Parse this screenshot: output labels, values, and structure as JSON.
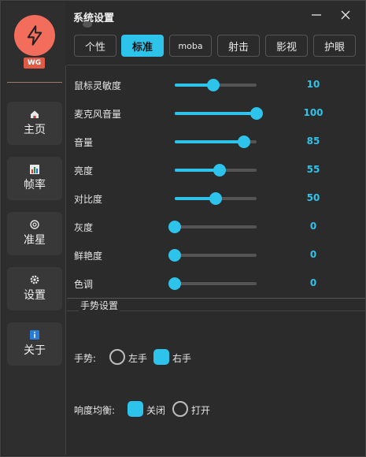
{
  "window": {
    "title": "系统设置"
  },
  "sidebar": {
    "badge": "WG",
    "items": [
      {
        "label": "主页",
        "icon": "home-icon"
      },
      {
        "label": "帧率",
        "icon": "chart-icon"
      },
      {
        "label": "准星",
        "icon": "crosshair-icon"
      },
      {
        "label": "设置",
        "icon": "gear-icon"
      },
      {
        "label": "关于",
        "icon": "info-icon"
      }
    ]
  },
  "tabs": [
    {
      "label": "个性",
      "active": false
    },
    {
      "label": "标准",
      "active": true
    },
    {
      "label": "moba",
      "active": false
    },
    {
      "label": "射击",
      "active": false
    },
    {
      "label": "影视",
      "active": false
    },
    {
      "label": "护眼",
      "active": false
    }
  ],
  "sliders": [
    {
      "label": "鼠标灵敏度",
      "value": 10,
      "min": 0,
      "max": 100
    },
    {
      "label": "麦克风音量",
      "value": 100,
      "min": 0,
      "max": 100
    },
    {
      "label": "音量",
      "value": 85,
      "min": 0,
      "max": 100
    },
    {
      "label": "亮度",
      "value": 55,
      "min": 0,
      "max": 100
    },
    {
      "label": "对比度",
      "value": 50,
      "min": 0,
      "max": 100
    },
    {
      "label": "灰度",
      "value": 0,
      "min": 0,
      "max": 100
    },
    {
      "label": "鲜艳度",
      "value": 0,
      "min": 0,
      "max": 100
    },
    {
      "label": "色调",
      "value": 0,
      "min": 0,
      "max": 100
    }
  ],
  "slider_knob_fraction": [
    0.47,
    1.0,
    0.85,
    0.55,
    0.5,
    0,
    0,
    0
  ],
  "gesture_group": {
    "title": "手势设置",
    "gesture": {
      "label": "手势:",
      "options": [
        "左手",
        "右手"
      ],
      "selected": "右手"
    },
    "response": {
      "label": "响度均衡:",
      "options": [
        "关闭",
        "打开"
      ],
      "selected": "关闭"
    }
  },
  "colors": {
    "accent": "#2ec3ea",
    "logo": "#f26d5b",
    "background": "#2b2b2b"
  }
}
